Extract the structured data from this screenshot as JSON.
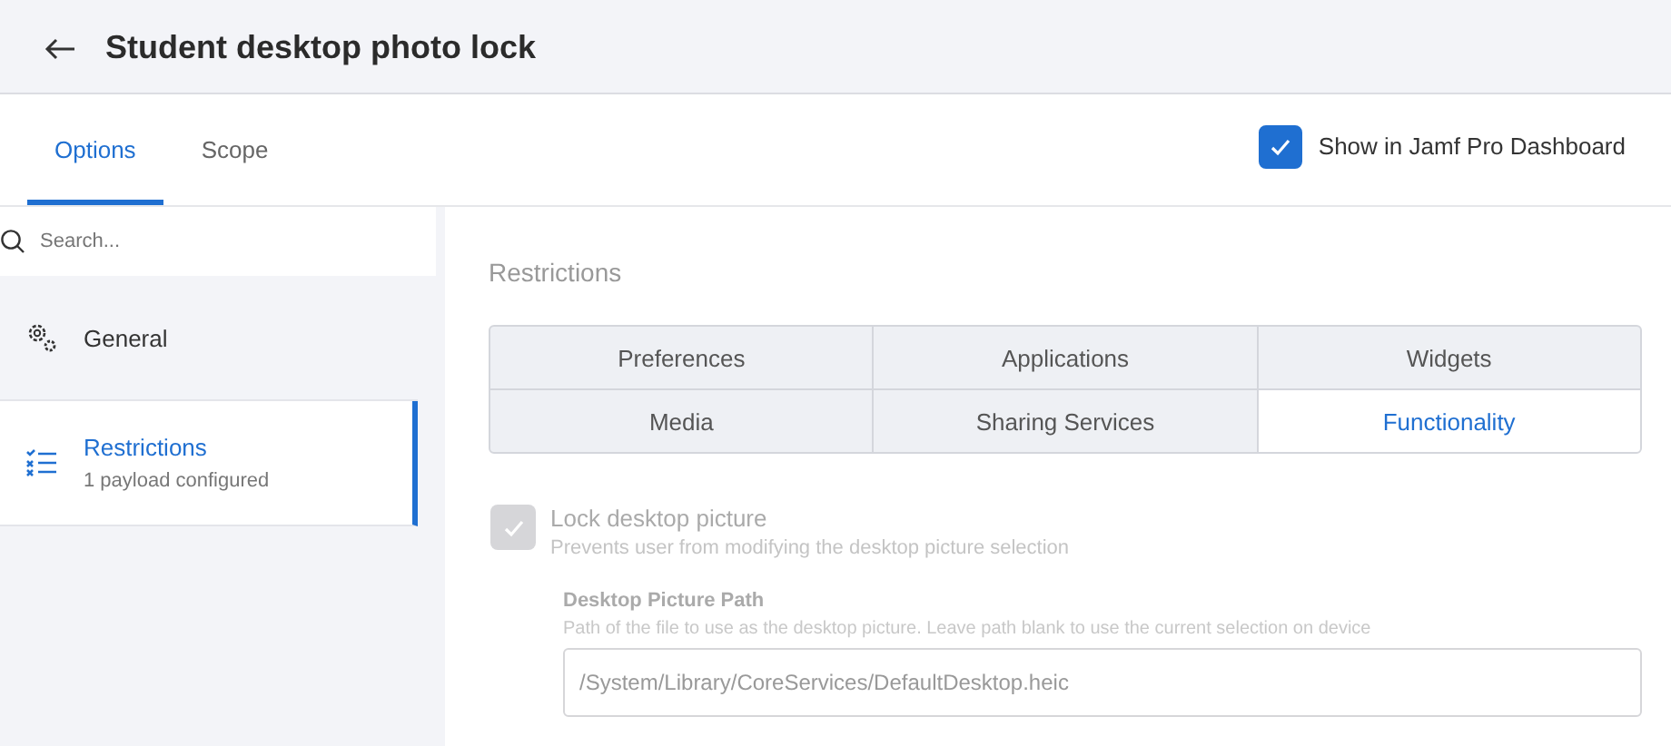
{
  "header": {
    "title": "Student desktop photo lock"
  },
  "tabs": [
    {
      "label": "Options",
      "selected": true
    },
    {
      "label": "Scope",
      "selected": false
    }
  ],
  "dashboard_toggle": {
    "label": "Show in Jamf Pro Dashboard",
    "checked": true
  },
  "sidebar": {
    "search": {
      "placeholder": "Search..."
    },
    "items": [
      {
        "kind": "gear",
        "label": "General",
        "selected": false
      },
      {
        "kind": "list",
        "label": "Restrictions",
        "subtitle": "1 payload configured",
        "selected": true
      }
    ]
  },
  "section_title": "Restrictions",
  "subtabs": [
    {
      "label": "Preferences",
      "selected": false
    },
    {
      "label": "Applications",
      "selected": false
    },
    {
      "label": "Widgets",
      "selected": false
    },
    {
      "label": "Media",
      "selected": false
    },
    {
      "label": "Sharing Services",
      "selected": false
    },
    {
      "label": "Functionality",
      "selected": true
    }
  ],
  "setting": {
    "label": "Lock desktop picture",
    "description": "Prevents user from modifying the desktop picture selection",
    "checked": true,
    "disabled": true
  },
  "field": {
    "label": "Desktop Picture Path",
    "description": "Path of the file to use as the desktop picture. Leave path blank to use the current selection on device",
    "value": "/System/Library/CoreServices/DefaultDesktop.heic",
    "disabled": true
  }
}
